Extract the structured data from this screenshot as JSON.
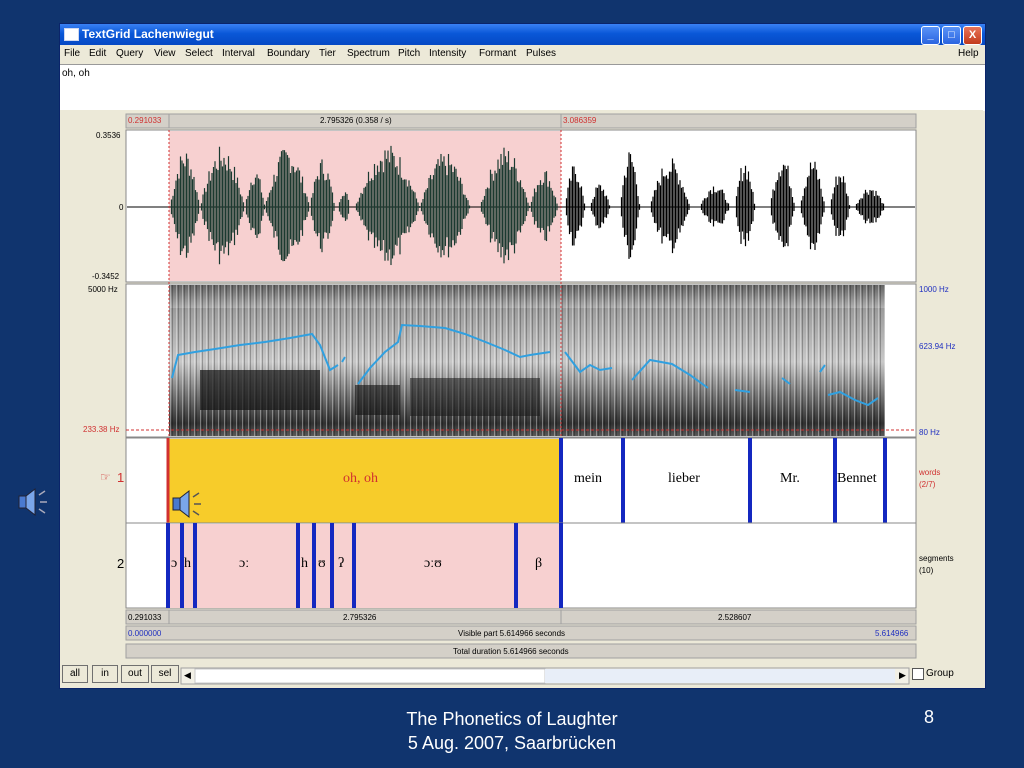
{
  "window": {
    "title": "TextGrid Lachenwiegut",
    "controls": {
      "minimize": "_",
      "maximize": "□",
      "close": "X"
    }
  },
  "menu": [
    "File",
    "Edit",
    "Query",
    "View",
    "Select",
    "Interval",
    "Boundary",
    "Tier",
    "Spectrum",
    "Pitch",
    "Intensity",
    "Formant",
    "Pulses"
  ],
  "help": "Help",
  "text_field": "oh, oh",
  "top_axis": {
    "left_time": "0.291033",
    "duration": "2.795326 (0.358 / s)",
    "right_time": "3.086359"
  },
  "waveform": {
    "max": "0.3536",
    "zero": "0",
    "min": "-0.3452"
  },
  "spectrogram": {
    "top_freq": "5000 Hz",
    "cursor_freq": "233.38 Hz",
    "pitch_top": "1000 Hz",
    "pitch_mid": "623.94 Hz",
    "pitch_bottom": "80 Hz"
  },
  "tiers": [
    {
      "number": "1",
      "marker": "☞",
      "name": "words",
      "count": "(2/7)",
      "intervals": [
        "oh, oh",
        "mein",
        "lieber",
        "Mr.",
        "Bennet"
      ]
    },
    {
      "number": "2",
      "name": "segments",
      "count": "(10)",
      "intervals": [
        "ɔ",
        "h",
        "ɔː",
        "h",
        "ʊ",
        "ʔ",
        "ɔːʊ",
        "β"
      ]
    }
  ],
  "bottom_axis": {
    "left_time": "0.291033",
    "sel_duration": "2.795326",
    "right_duration": "2.528607",
    "visible_start": "0.000000",
    "visible_label": "Visible part 5.614966 seconds",
    "visible_end": "5.614966",
    "total_label": "Total duration 5.614966 seconds"
  },
  "buttons": [
    "all",
    "in",
    "out",
    "sel"
  ],
  "group_label": "Group",
  "footer": {
    "line1": "The Phonetics of Laughter",
    "line2": "5 Aug. 2007, Saarbrücken",
    "page": "8"
  },
  "colors": {
    "selection": "#f7d0d0",
    "highlight_interval": "#f7cc2a",
    "boundary": "#1428c0",
    "pitch": "#30a0e0",
    "background": "#10346e"
  }
}
